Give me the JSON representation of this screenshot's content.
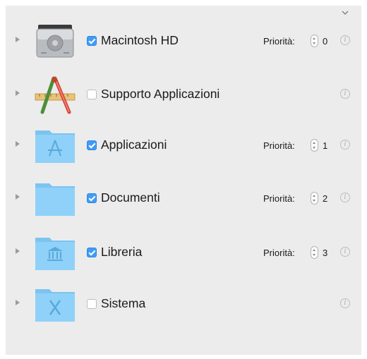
{
  "priority_label": "Priorità:",
  "info_glyph": "i",
  "colors": {
    "panel_background": "#ececec",
    "checkbox_checked": "#3f9cf7",
    "folder_blue": "#8fd1f8"
  },
  "items": [
    {
      "label": "Macintosh HD",
      "checked": true,
      "priority": "0",
      "icon": "hard-drive-icon"
    },
    {
      "label": "Supporto Applicazioni",
      "checked": false,
      "priority": null,
      "icon": "developer-tools-icon"
    },
    {
      "label": "Applicazioni",
      "checked": true,
      "priority": "1",
      "icon": "applications-folder-icon"
    },
    {
      "label": "Documenti",
      "checked": true,
      "priority": "2",
      "icon": "documents-folder-icon"
    },
    {
      "label": "Libreria",
      "checked": true,
      "priority": "3",
      "icon": "library-folder-icon"
    },
    {
      "label": "Sistema",
      "checked": false,
      "priority": null,
      "icon": "system-folder-icon"
    }
  ]
}
